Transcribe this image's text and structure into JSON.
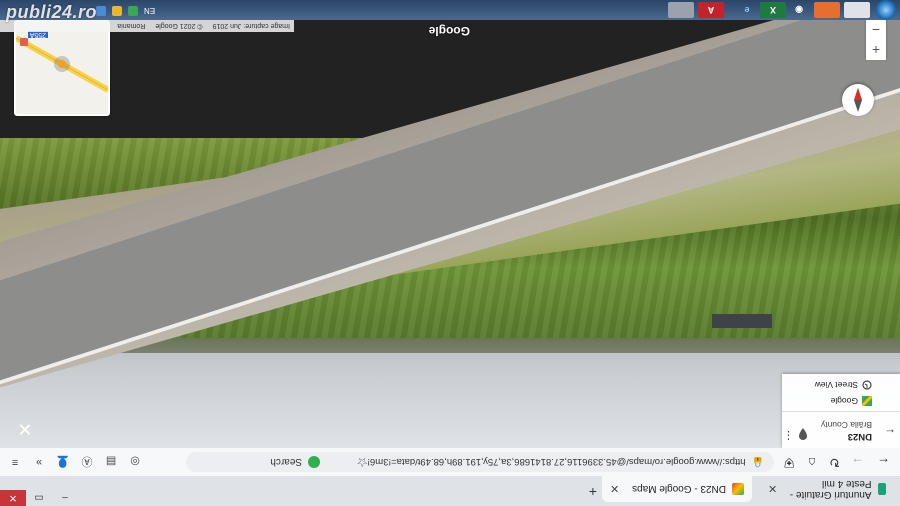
{
  "browser": {
    "tabs": [
      {
        "label": "Anunturi Gratuite - Peste 4 mil"
      },
      {
        "label": "DN23 - Google Maps"
      }
    ],
    "new_tab_label": "+",
    "url": "https://www.google.ro/maps/@45.3396116,27.8141686,3a,75y,191.89h,68.49t/data=!3m6!",
    "search_placeholder": "Search"
  },
  "place_card": {
    "title": "DN23",
    "subtitle": "Brăila County",
    "links": [
      {
        "label": "Google"
      },
      {
        "label": "Street View"
      }
    ]
  },
  "map": {
    "brand": "Google",
    "minimap_road_label": "255A",
    "footer": {
      "capture": "Image capture: Jun 2019",
      "copyright": "© 2021 Google",
      "country": "Romania"
    },
    "zoom_in_label": "+",
    "zoom_out_label": "−"
  },
  "taskbar": {
    "language": "EN"
  },
  "watermark": "publi24.ro",
  "colors": {
    "grass": "#587a2c",
    "road": "#8d8d8c",
    "taskbar": "#2a4568",
    "accent_red": "#c7353a"
  }
}
